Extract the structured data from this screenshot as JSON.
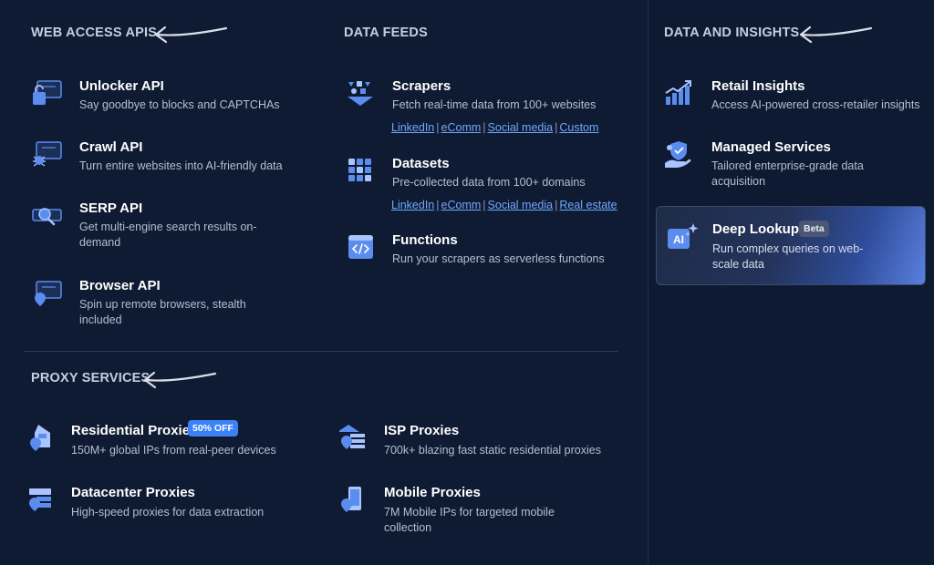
{
  "web_access": {
    "title": "WEB ACCESS APIS",
    "items": [
      {
        "title": "Unlocker API",
        "desc": "Say goodbye to blocks and CAPTCHAs"
      },
      {
        "title": "Crawl API",
        "desc": "Turn entire websites into AI-friendly data"
      },
      {
        "title": "SERP API",
        "desc": "Get multi-engine search results on-demand"
      },
      {
        "title": "Browser API",
        "desc": "Spin up remote browsers, stealth included"
      }
    ]
  },
  "data_feeds": {
    "title": "DATA FEEDS",
    "scrapers": {
      "title": "Scrapers",
      "desc": "Fetch real-time data from 100+ websites",
      "links": [
        "LinkedIn",
        "eComm",
        "Social media",
        "Custom"
      ]
    },
    "datasets": {
      "title": "Datasets",
      "desc": "Pre-collected data from 100+ domains",
      "links": [
        "LinkedIn",
        "eComm",
        "Social media",
        "Real estate"
      ]
    },
    "functions": {
      "title": "Functions",
      "desc": "Run your scrapers as serverless functions"
    }
  },
  "proxy": {
    "title": "PROXY SERVICES",
    "residential": {
      "title": "Residential Proxies",
      "badge": "50% OFF",
      "desc": "150M+ global IPs from real-peer devices"
    },
    "isp": {
      "title": "ISP Proxies",
      "desc": "700k+ blazing fast static residential proxies"
    },
    "datacenter": {
      "title": "Datacenter Proxies",
      "desc": "High-speed proxies for data extraction"
    },
    "mobile": {
      "title": "Mobile Proxies",
      "desc": "7M Mobile IPs for targeted mobile collection"
    }
  },
  "insights": {
    "title": "DATA AND INSIGHTS",
    "retail": {
      "title": "Retail Insights",
      "desc": "Access AI-powered cross-retailer insights"
    },
    "managed": {
      "title": "Managed Services",
      "desc": "Tailored enterprise-grade data acquisition"
    },
    "deep_lookup": {
      "title": "Deep Lookup",
      "badge": "Beta",
      "desc": "Run complex queries on web-scale data",
      "icon_text": "AI"
    }
  },
  "icons": {
    "unlocker": "unlocker-icon",
    "crawl": "crawl-bug-icon",
    "serp": "search-icon",
    "browser": "browser-icon",
    "scrapers": "scraper-funnel-icon",
    "datasets": "grid-icon",
    "functions": "code-icon",
    "residential": "house-icon",
    "isp": "server-pin-icon",
    "datacenter": "datacenter-icon",
    "mobile": "mobile-pin-icon",
    "retail": "chart-up-icon",
    "managed": "hand-shield-icon",
    "deep_lookup": "ai-sparkle-icon",
    "arrow": "hand-drawn-arrow-icon"
  },
  "colors": {
    "background": "#0f1b33",
    "icon_primary": "#5b8def",
    "icon_light": "#a9c4ff",
    "link": "#6ea8ff",
    "badge_off": "#3b82f6"
  }
}
